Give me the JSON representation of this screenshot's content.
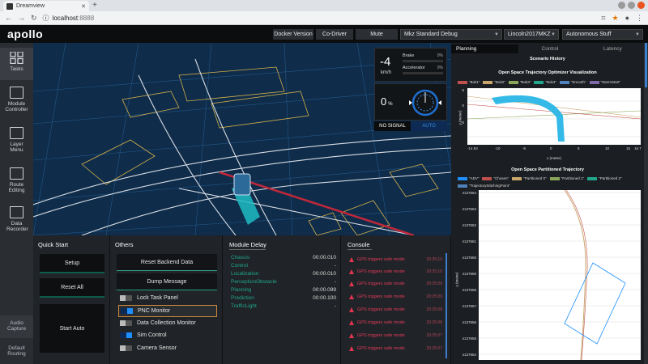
{
  "browser": {
    "tab_title": "Dreamview",
    "url_host": "localhost",
    "url_port": ":8888"
  },
  "header": {
    "logo": "apollo",
    "docker_version": "Docker Version",
    "co_driver": "Co-Driver",
    "mute": "Mute",
    "mode_select": "Mkz Standard Debug",
    "vehicle_select": "Lincoln2017MKZ",
    "map_select": "Autonomous Stuff"
  },
  "sidebar": {
    "items": [
      {
        "label": "Tasks",
        "icon": "grid-icon"
      },
      {
        "label": "Module Controller",
        "icon": "module-controller-icon"
      },
      {
        "label": "Layer Menu",
        "icon": "layer-menu-icon"
      },
      {
        "label": "Route Editing",
        "icon": "route-editing-icon"
      },
      {
        "label": "Data Recorder",
        "icon": "data-recorder-icon"
      }
    ],
    "bottom": [
      {
        "label": "Audio Capture"
      },
      {
        "label": "Default Routing"
      }
    ]
  },
  "dashboard": {
    "speed": "-4",
    "speed_unit": "km/h",
    "brake_label": "Brake",
    "brake_pct": "0%",
    "brake_value": 0,
    "accelerator_label": "Accelerator",
    "accelerator_pct": "0%",
    "accelerator_value": 0,
    "steering": "0",
    "steering_unit": "%",
    "signal": "NO SIGNAL",
    "driving_mode": "AUTO"
  },
  "quick_start": {
    "title": "Quick Start",
    "setup": "Setup",
    "reset_all": "Reset All",
    "start_auto": "Start Auto"
  },
  "others": {
    "title": "Others",
    "reset_backend": "Reset Backend Data",
    "dump_message": "Dump Message",
    "toggles": [
      {
        "label": "Lock Task Panel",
        "on": false
      },
      {
        "label": "PNC Monitor",
        "on": true
      },
      {
        "label": "Data Collection Monitor",
        "on": false
      },
      {
        "label": "Sim Control",
        "on": true
      },
      {
        "label": "Camera Sensor",
        "on": false
      }
    ]
  },
  "module_delay": {
    "title": "Module Delay",
    "rows": [
      {
        "name": "Chassis",
        "value": "00:00.010"
      },
      {
        "name": "Control",
        "value": "-"
      },
      {
        "name": "Localization",
        "value": "00:00.010"
      },
      {
        "name": "PerceptionObstacle",
        "value": "-"
      },
      {
        "name": "Planning",
        "value": "00:00.099"
      },
      {
        "name": "Prediction",
        "value": "00:00.100"
      },
      {
        "name": "TrafficLight",
        "value": "-"
      }
    ]
  },
  "console": {
    "title": "Console",
    "rows": [
      {
        "msg": "GPS triggers safe mode",
        "time": "20:25:10"
      },
      {
        "msg": "GPS triggers safe mode",
        "time": "20:25:10"
      },
      {
        "msg": "GPS triggers safe mode",
        "time": "20:25:09"
      },
      {
        "msg": "GPS triggers safe mode",
        "time": "20:25:09"
      },
      {
        "msg": "GPS triggers safe mode",
        "time": "20:25:08"
      },
      {
        "msg": "GPS triggers safe mode",
        "time": "20:25:08"
      },
      {
        "msg": "GPS triggers safe mode",
        "time": "20:25:07"
      },
      {
        "msg": "GPS triggers safe mode",
        "time": "20:25:07"
      }
    ]
  },
  "right_panel": {
    "tabs": [
      "Planning",
      "Control",
      "Latency"
    ],
    "scenario_history": "Scenario History",
    "chart1": {
      "title": "Open Space Trajectory Optimizer Visualization",
      "legend": [
        {
          "name": "\"Bok1\"",
          "color": "#c0504d"
        },
        {
          "name": "\"Bok2\"",
          "color": "#c9a66b"
        },
        {
          "name": "\"Bok3\"",
          "color": "#8aa65a"
        },
        {
          "name": "\"Bok4\"",
          "color": "#1fa88c"
        },
        {
          "name": "\"Smooth\"",
          "color": "#4f81bd"
        },
        {
          "name": "\"WarmStart\"",
          "color": "#7f6aa8"
        }
      ],
      "ylabel": "y (meter)",
      "xlabel": "x (meter)",
      "y_ticks": [
        "5",
        "0",
        "-5"
      ],
      "x_ticks": [
        "-14.93",
        "-10",
        "-5",
        "0",
        "5",
        "10",
        "15",
        "16.7"
      ]
    },
    "chart2": {
      "title": "Open Space Partitioned Trajectory",
      "legend": [
        {
          "name": "\"ADV\"",
          "color": "#1e90ff"
        },
        {
          "name": "\"Chosen\"",
          "color": "#c0504d"
        },
        {
          "name": "\"Partitioned 0\"",
          "color": "#c9a66b"
        },
        {
          "name": "\"Partitioned 1\"",
          "color": "#8aa65a"
        },
        {
          "name": "\"Partitioned 2\"",
          "color": "#1fa88c"
        },
        {
          "name": "\"TrajectoryStitchingPoint\"",
          "color": "#4f81bd"
        }
      ],
      "ylabel": "y (meter)",
      "y_ticks": [
        "4137664",
        "4137663",
        "4137662",
        "4137661",
        "4137660",
        "4137659",
        "4137658",
        "4137657",
        "4137656",
        "4137655",
        "4137654"
      ]
    }
  },
  "colors": {
    "accent_green": "#1fa88c",
    "error_red": "#e33b5a",
    "scene_bg": "#0f2c4a",
    "lane_yellow": "#d4b24a"
  }
}
